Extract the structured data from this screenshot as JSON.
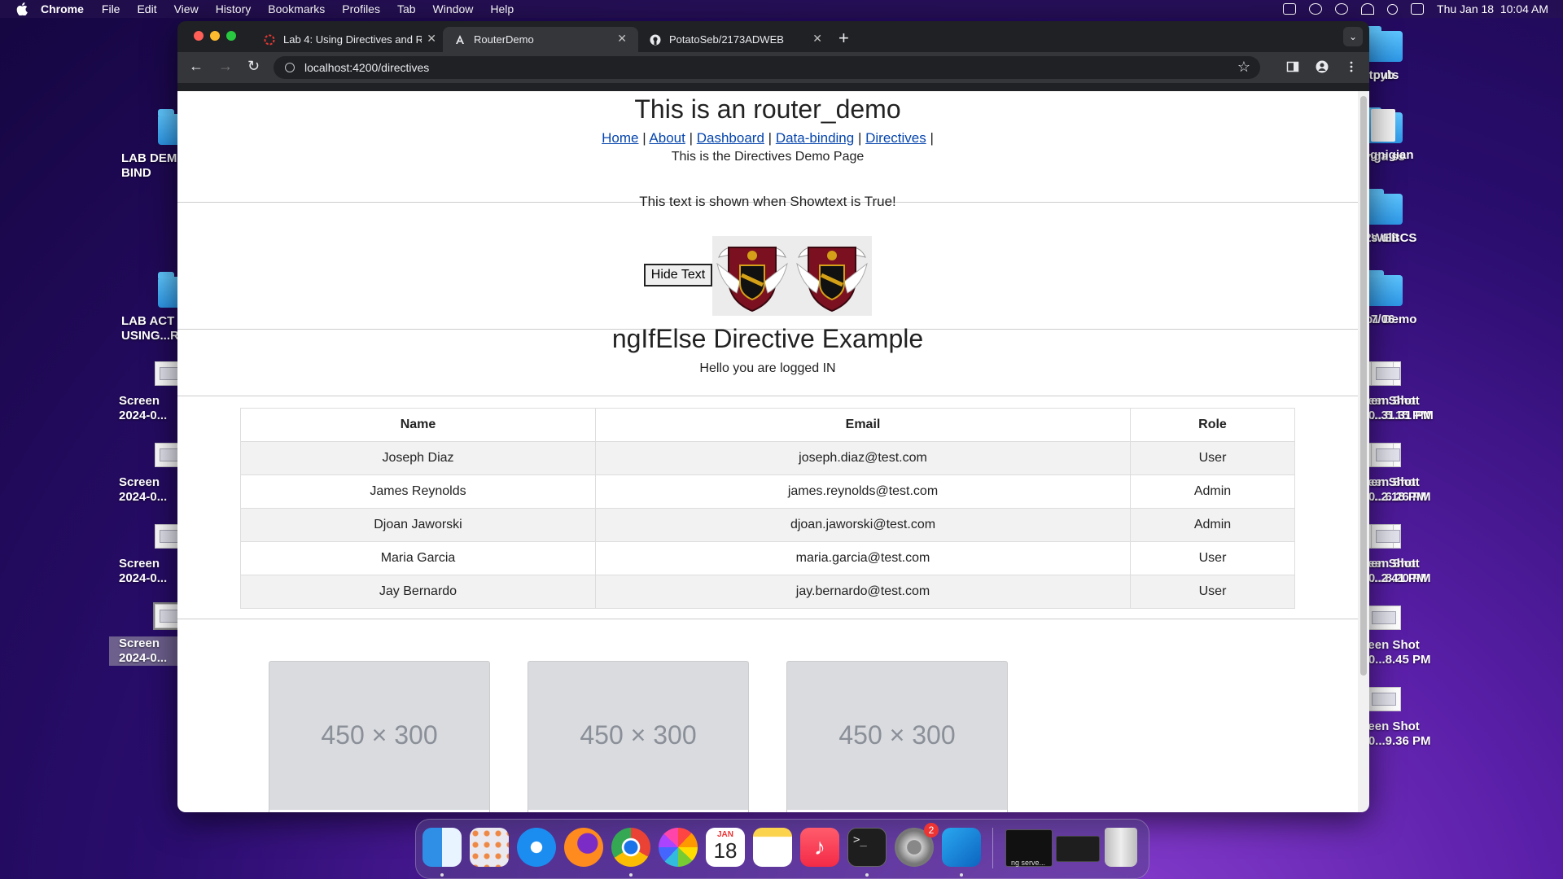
{
  "menubar": {
    "app": "Chrome",
    "items": [
      "File",
      "Edit",
      "View",
      "History",
      "Bookmarks",
      "Profiles",
      "Tab",
      "Window",
      "Help"
    ],
    "datetime": "Thu Jan 18  10:04 AM"
  },
  "desktop": {
    "right_col1": [
      "n outputs",
      "ognigian",
      "s ulit",
      "7/06",
      "en Shot\n...31.31 PM",
      "en Shot\n...2.18 PM",
      "en Shot\n...2.41 PM"
    ],
    "right_col2": [
      "cyb",
      "mga ss",
      "202WEBCS",
      "Lab1 Demo",
      "Screen Shot\n2024-0...5.15 PM",
      "Screen Shot\n2024-0...6.26 PM",
      "Screen Shot\n2024-0...8.20 PM",
      "Screen Shot\n2024-0...8.45 PM",
      "Screen Shot\n2024-0...9.36 PM"
    ],
    "left_col": [
      "LAB DEM\nBIND",
      "LAB ACT\nUSING...R",
      "Screen\n2024-0...",
      "Screen\n2024-0...",
      "Screen\n2024-0...",
      "Screen\n2024-0..."
    ]
  },
  "browser": {
    "tabs": [
      {
        "title": "Lab 4: Using Directives and R",
        "icon": "loading-spinner-icon"
      },
      {
        "title": "RouterDemo",
        "icon": "angular-icon"
      },
      {
        "title": "PotatoSeb/2173ADWEB",
        "icon": "github-icon"
      }
    ],
    "new_tab": "+",
    "url": "localhost:4200/directives"
  },
  "page": {
    "title": "This is an router_demo",
    "nav_links": [
      "Home",
      "About",
      "Dashboard",
      "Data-binding",
      "Directives"
    ],
    "separator": "|",
    "subtitle": "This is the Directives Demo Page",
    "show_text": "This text is shown when Showtext is True!",
    "hide_button": "Hide Text",
    "ngif_title": "ngIfElse Directive Example",
    "logged_in": "Hello you are logged IN",
    "table": {
      "headers": [
        "Name",
        "Email",
        "Role"
      ],
      "rows": [
        [
          "Joseph Diaz",
          "joseph.diaz@test.com",
          "User"
        ],
        [
          "James Reynolds",
          "james.reynolds@test.com",
          "Admin"
        ],
        [
          "Djoan Jaworski",
          "djoan.jaworski@test.com",
          "Admin"
        ],
        [
          "Maria Garcia",
          "maria.garcia@test.com",
          "User"
        ],
        [
          "Jay Bernardo",
          "jay.bernardo@test.com",
          "User"
        ]
      ]
    },
    "placeholder_cards": [
      "450 × 300",
      "450 × 300",
      "450 × 300"
    ]
  },
  "dock": {
    "apps": [
      "finder-icon",
      "launchpad-icon",
      "safari-icon",
      "firefox-icon",
      "chrome-icon",
      "photos-icon",
      "calendar-icon",
      "notes-icon",
      "music-icon",
      "terminal-icon",
      "system-settings-icon",
      "vscode-icon"
    ],
    "calendar": {
      "month": "JAN",
      "day": "18"
    },
    "settings_badge": "2",
    "terminal_window_label": "ng serve..."
  },
  "colors": {
    "link": "#0645ad",
    "table_stripe": "#f2f2f2",
    "chrome_dark": "#202124",
    "chrome_toolbar": "#35363a"
  }
}
